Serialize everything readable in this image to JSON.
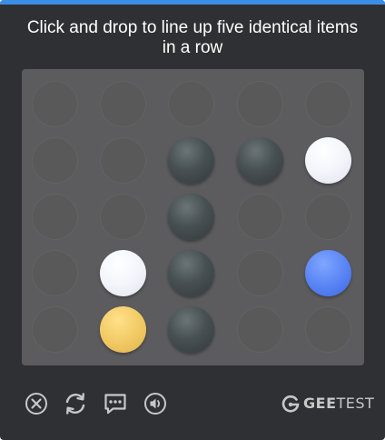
{
  "instruction": "Click and drop to line up five identical items in a row",
  "board": {
    "rows": 5,
    "cols": 5,
    "cells": [
      [
        "empty",
        "empty",
        "empty",
        "empty",
        "empty"
      ],
      [
        "empty",
        "empty",
        "dark",
        "dark",
        "white"
      ],
      [
        "empty",
        "empty",
        "dark",
        "empty",
        "empty"
      ],
      [
        "empty",
        "white",
        "dark",
        "empty",
        "blue"
      ],
      [
        "empty",
        "yellow",
        "dark",
        "empty",
        "empty"
      ]
    ]
  },
  "footer": {
    "icons": [
      "close-icon",
      "refresh-icon",
      "feedback-icon",
      "audio-icon"
    ],
    "brand_prefix": "GEE",
    "brand_suffix": "TEST"
  },
  "colors": {
    "panel_bg": "#2f3033",
    "board_bg": "#5c5c5e",
    "accent_bar": "#3a8ee6",
    "icon_color": "#c7c8ca"
  }
}
